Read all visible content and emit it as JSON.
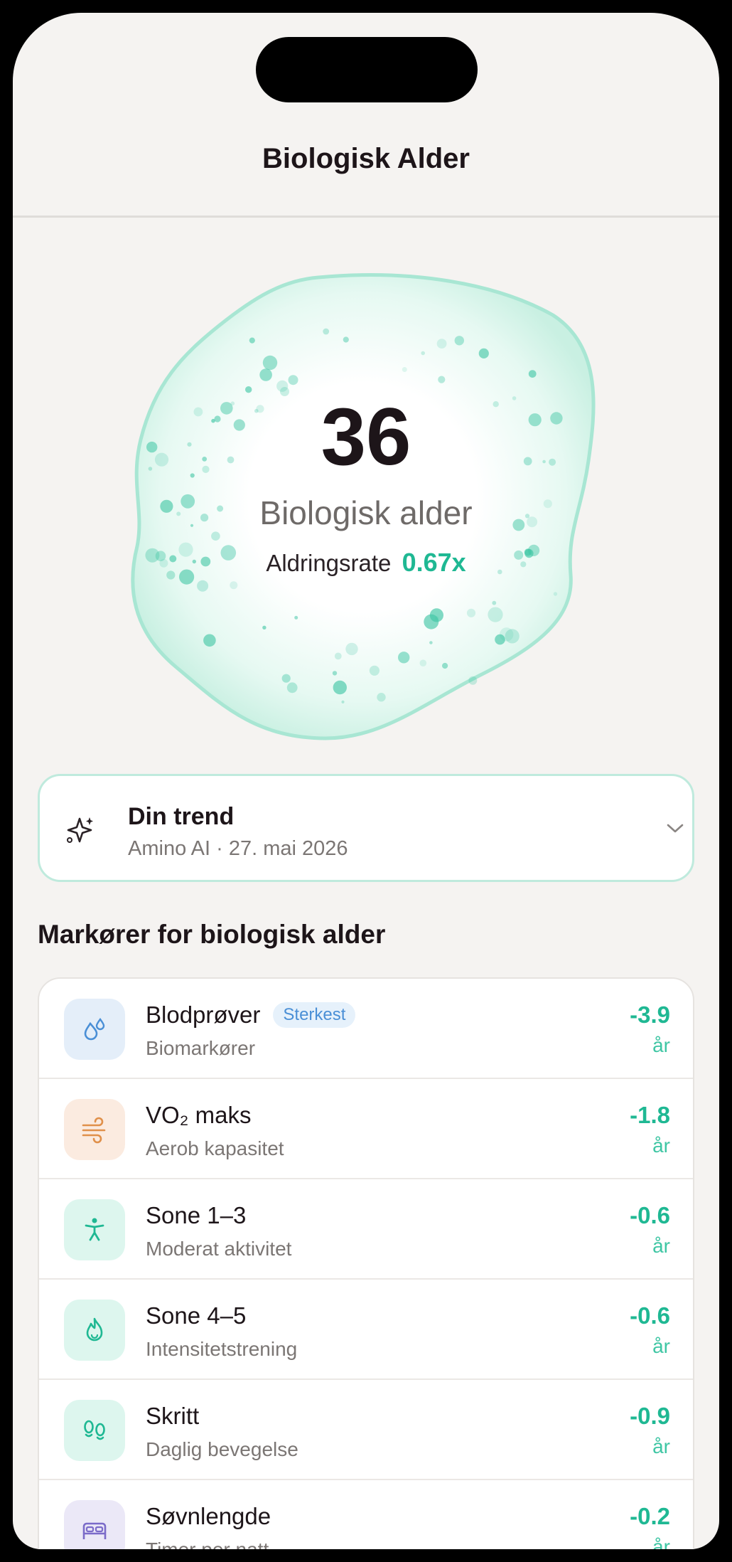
{
  "nav": {
    "title": "Biologisk Alder"
  },
  "hero": {
    "age": "36",
    "label": "Biologisk alder",
    "rate_label": "Aldringsrate",
    "rate_value": "0.67x"
  },
  "trend": {
    "icon": "sparkles-icon",
    "title": "Din trend",
    "subtitle": "Amino AI · 27. mai 2026"
  },
  "markers": {
    "title": "Markører for biologisk alder",
    "items": [
      {
        "title": "Blodprøver",
        "badge": "Sterkest",
        "subtitle": "Biomarkører",
        "value": "-3.9",
        "unit": "år",
        "icon": "blood-drop-icon",
        "icon_bg": "#e4eef9",
        "icon_color": "#4a8fd6"
      },
      {
        "title": "VO₂ maks",
        "subtitle": "Aerob kapasitet",
        "value": "-1.8",
        "unit": "år",
        "icon": "wind-icon",
        "icon_bg": "#fbebe0",
        "icon_color": "#e0904a"
      },
      {
        "title": "Sone 1–3",
        "subtitle": "Moderat aktivitet",
        "value": "-0.6",
        "unit": "år",
        "icon": "person-icon",
        "icon_bg": "#ddf6ee",
        "icon_color": "#1fb893"
      },
      {
        "title": "Sone 4–5",
        "subtitle": "Intensitetstrening",
        "value": "-0.6",
        "unit": "år",
        "icon": "flame-icon",
        "icon_bg": "#ddf6ee",
        "icon_color": "#1fb893"
      },
      {
        "title": "Skritt",
        "subtitle": "Daglig bevegelse",
        "value": "-0.9",
        "unit": "år",
        "icon": "footsteps-icon",
        "icon_bg": "#ddf6ee",
        "icon_color": "#1fb893"
      },
      {
        "title": "Søvnlengde",
        "subtitle": "Timer per natt",
        "value": "-0.2",
        "unit": "år",
        "icon": "bed-icon",
        "icon_bg": "#ebe8f7",
        "icon_color": "#7b6bc9"
      }
    ]
  },
  "colors": {
    "accent": "#1fb893",
    "blob_fill": "#e9faf4",
    "blob_stroke": "#a8e6d3"
  }
}
